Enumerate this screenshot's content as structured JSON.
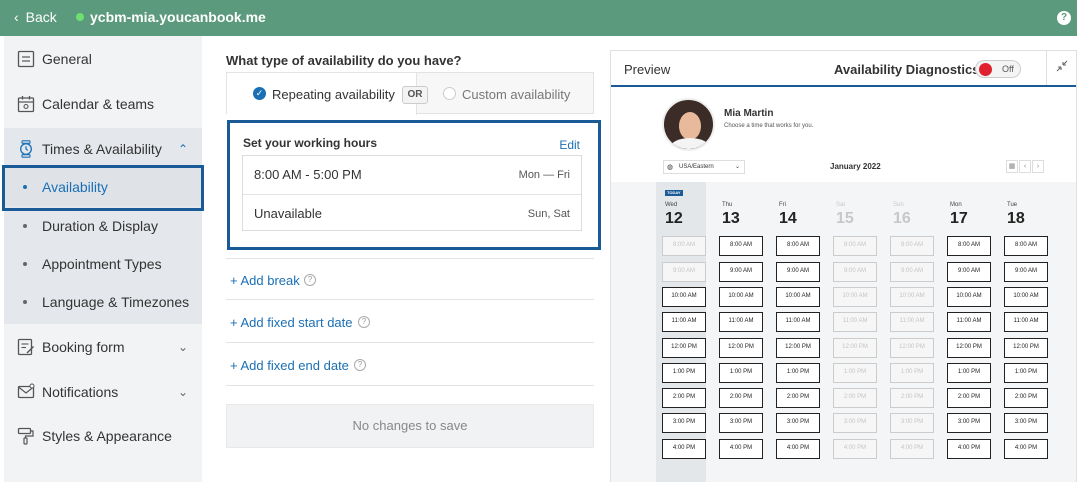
{
  "topbar": {
    "back_label": "Back",
    "site_name": "ycbm-mia.youcanbook.me",
    "help": "?"
  },
  "sidebar": {
    "items": [
      {
        "label": "General",
        "icon": "general-icon"
      },
      {
        "label": "Calendar & teams",
        "icon": "calendar-icon"
      },
      {
        "label": "Times & Availability",
        "icon": "clock-icon",
        "expanded": true
      },
      {
        "label": "Booking form",
        "icon": "form-icon"
      },
      {
        "label": "Notifications",
        "icon": "mail-icon"
      },
      {
        "label": "Styles & Appearance",
        "icon": "paint-roller-icon"
      }
    ],
    "sub_items": [
      {
        "label": "Availability",
        "active": true
      },
      {
        "label": "Duration & Display"
      },
      {
        "label": "Appointment Types"
      },
      {
        "label": "Language & Timezones"
      }
    ]
  },
  "main": {
    "question": "What type of availability do you have?",
    "option_repeating": "Repeating availability",
    "or_label": "OR",
    "option_custom": "Custom availability",
    "working_hours": {
      "title": "Set your working hours",
      "edit": "Edit",
      "rows": [
        {
          "time": "8:00 AM - 5:00 PM",
          "days": "Mon — Fri"
        },
        {
          "time": "Unavailable",
          "days": "Sun, Sat"
        }
      ]
    },
    "links": [
      "+ Add break",
      "+ Add fixed start date",
      "+ Add fixed end date"
    ],
    "save_label": "No changes to save"
  },
  "preview": {
    "title": "Preview",
    "diagnostics_label": "Availability Diagnostics",
    "switch_label": "Off",
    "name": "Mia Martin",
    "subtitle": "Choose a time that works for you.",
    "timezone": "USA/Eastern",
    "month": "January 2022",
    "today_tag": "TODAY",
    "days": [
      {
        "name": "Wed",
        "num": "12",
        "today": true,
        "disabled": false,
        "unavailable_slots": [
          0,
          1
        ]
      },
      {
        "name": "Thu",
        "num": "13",
        "today": false,
        "disabled": false,
        "unavailable_slots": []
      },
      {
        "name": "Fri",
        "num": "14",
        "today": false,
        "disabled": false,
        "unavailable_slots": []
      },
      {
        "name": "Sat",
        "num": "15",
        "today": false,
        "disabled": true,
        "unavailable_slots": []
      },
      {
        "name": "Sun",
        "num": "16",
        "today": false,
        "disabled": true,
        "unavailable_slots": []
      },
      {
        "name": "Mon",
        "num": "17",
        "today": false,
        "disabled": false,
        "unavailable_slots": []
      },
      {
        "name": "Tue",
        "num": "18",
        "today": false,
        "disabled": false,
        "unavailable_slots": []
      }
    ],
    "slots": [
      "8:00 AM",
      "9:00 AM",
      "10:00 AM",
      "11:00 AM",
      "12:00 PM",
      "1:00 PM",
      "2:00 PM",
      "3:00 PM",
      "4:00 PM"
    ]
  },
  "colors": {
    "topbar": "#5b9a7c",
    "accent": "#1a6fb5",
    "highlight_border": "#1a5a96",
    "switch_off": "#e0202e"
  }
}
